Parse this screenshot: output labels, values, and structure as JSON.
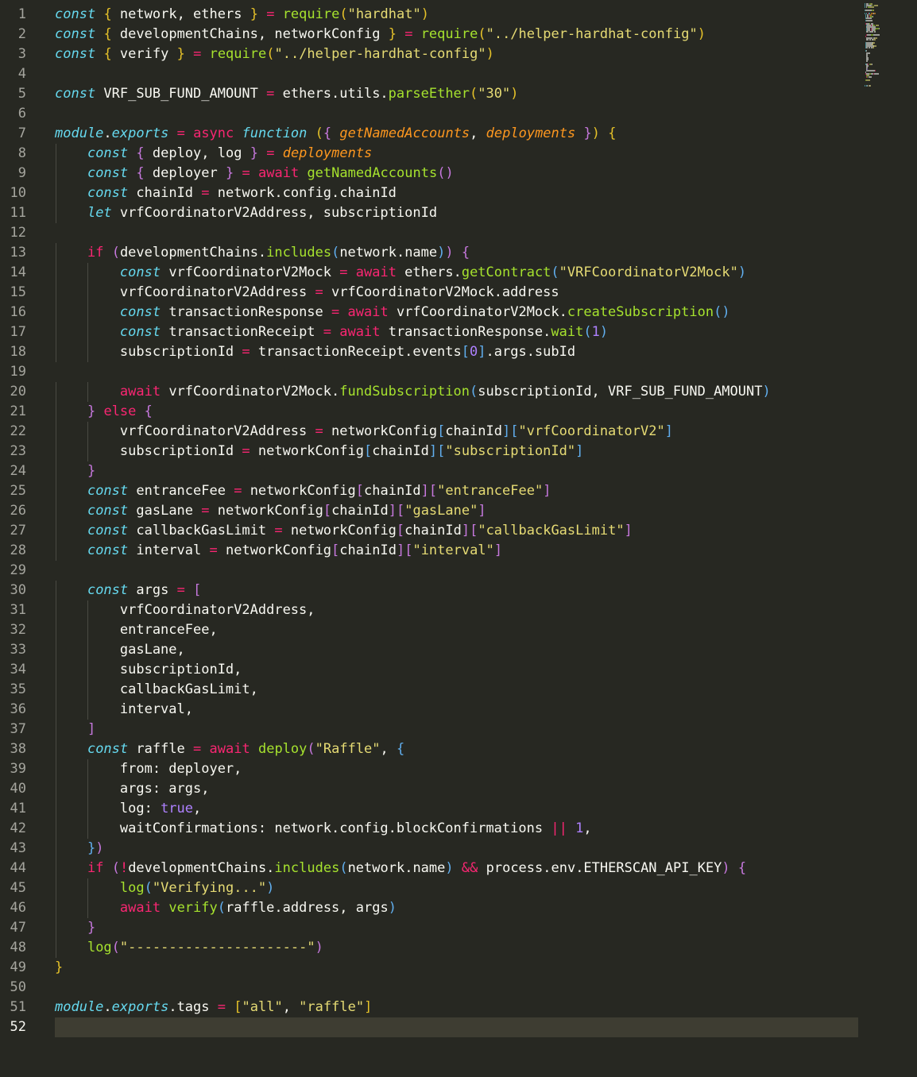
{
  "editor": {
    "language": "javascript",
    "current_line": 52,
    "lines": [
      [
        [
          "kwi",
          "const"
        ],
        [
          "p",
          " "
        ],
        [
          "br",
          "{"
        ],
        [
          "p",
          " network, ethers "
        ],
        [
          "br",
          "}"
        ],
        [
          "p",
          " "
        ],
        [
          "op",
          "="
        ],
        [
          "p",
          " "
        ],
        [
          "fn",
          "require"
        ],
        [
          "br",
          "("
        ],
        [
          "str",
          "\"hardhat\""
        ],
        [
          "br",
          ")"
        ]
      ],
      [
        [
          "kwi",
          "const"
        ],
        [
          "p",
          " "
        ],
        [
          "br",
          "{"
        ],
        [
          "p",
          " developmentChains, networkConfig "
        ],
        [
          "br",
          "}"
        ],
        [
          "p",
          " "
        ],
        [
          "op",
          "="
        ],
        [
          "p",
          " "
        ],
        [
          "fn",
          "require"
        ],
        [
          "br",
          "("
        ],
        [
          "str",
          "\"../helper-hardhat-config\""
        ],
        [
          "br",
          ")"
        ]
      ],
      [
        [
          "kwi",
          "const"
        ],
        [
          "p",
          " "
        ],
        [
          "br",
          "{"
        ],
        [
          "p",
          " verify "
        ],
        [
          "br",
          "}"
        ],
        [
          "p",
          " "
        ],
        [
          "op",
          "="
        ],
        [
          "p",
          " "
        ],
        [
          "fn",
          "require"
        ],
        [
          "br",
          "("
        ],
        [
          "str",
          "\"../helper-hardhat-config\""
        ],
        [
          "br",
          ")"
        ]
      ],
      [],
      [
        [
          "kwi",
          "const"
        ],
        [
          "p",
          " VRF_SUB_FUND_AMOUNT "
        ],
        [
          "op",
          "="
        ],
        [
          "p",
          " ethers.utils."
        ],
        [
          "fn",
          "parseEther"
        ],
        [
          "br",
          "("
        ],
        [
          "str",
          "\"30\""
        ],
        [
          "br",
          ")"
        ]
      ],
      [],
      [
        [
          "kwi",
          "module"
        ],
        [
          "p",
          "."
        ],
        [
          "kwi",
          "exports"
        ],
        [
          "p",
          " "
        ],
        [
          "op",
          "="
        ],
        [
          "p",
          " "
        ],
        [
          "kw",
          "async"
        ],
        [
          "p",
          " "
        ],
        [
          "kwi",
          "function"
        ],
        [
          "p",
          " "
        ],
        [
          "br",
          "("
        ],
        [
          "br",
          "{"
        ],
        [
          "p",
          " "
        ],
        [
          "prm",
          "getNamedAccounts"
        ],
        [
          "p",
          ", "
        ],
        [
          "prm",
          "deployments"
        ],
        [
          "p",
          " "
        ],
        [
          "br",
          "}"
        ],
        [
          "br",
          ")"
        ],
        [
          "p",
          " "
        ],
        [
          "br",
          "{"
        ]
      ],
      [
        [
          "p",
          "    "
        ],
        [
          "kwi",
          "const"
        ],
        [
          "p",
          " "
        ],
        [
          "br",
          "{"
        ],
        [
          "p",
          " deploy, log "
        ],
        [
          "br",
          "}"
        ],
        [
          "p",
          " "
        ],
        [
          "op",
          "="
        ],
        [
          "p",
          " "
        ],
        [
          "prm",
          "deployments"
        ]
      ],
      [
        [
          "p",
          "    "
        ],
        [
          "kwi",
          "const"
        ],
        [
          "p",
          " "
        ],
        [
          "br",
          "{"
        ],
        [
          "p",
          " deployer "
        ],
        [
          "br",
          "}"
        ],
        [
          "p",
          " "
        ],
        [
          "op",
          "="
        ],
        [
          "p",
          " "
        ],
        [
          "kw",
          "await"
        ],
        [
          "p",
          " "
        ],
        [
          "fn",
          "getNamedAccounts"
        ],
        [
          "br",
          "()"
        ]
      ],
      [
        [
          "p",
          "    "
        ],
        [
          "kwi",
          "const"
        ],
        [
          "p",
          " chainId "
        ],
        [
          "op",
          "="
        ],
        [
          "p",
          " network.config.chainId"
        ]
      ],
      [
        [
          "p",
          "    "
        ],
        [
          "kwi",
          "let"
        ],
        [
          "p",
          " vrfCoordinatorV2Address, subscriptionId"
        ]
      ],
      [],
      [
        [
          "p",
          "    "
        ],
        [
          "kw",
          "if"
        ],
        [
          "p",
          " "
        ],
        [
          "br",
          "("
        ],
        [
          "p",
          "developmentChains."
        ],
        [
          "fn",
          "includes"
        ],
        [
          "br",
          "("
        ],
        [
          "p",
          "network.name"
        ],
        [
          "br",
          "))"
        ],
        [
          "p",
          " "
        ],
        [
          "br",
          "{"
        ]
      ],
      [
        [
          "p",
          "        "
        ],
        [
          "kwi",
          "const"
        ],
        [
          "p",
          " vrfCoordinatorV2Mock "
        ],
        [
          "op",
          "="
        ],
        [
          "p",
          " "
        ],
        [
          "kw",
          "await"
        ],
        [
          "p",
          " ethers."
        ],
        [
          "fn",
          "getContract"
        ],
        [
          "br",
          "("
        ],
        [
          "str",
          "\"VRFCoordinatorV2Mock\""
        ],
        [
          "br",
          ")"
        ]
      ],
      [
        [
          "p",
          "        vrfCoordinatorV2Address "
        ],
        [
          "op",
          "="
        ],
        [
          "p",
          " vrfCoordinatorV2Mock.address"
        ]
      ],
      [
        [
          "p",
          "        "
        ],
        [
          "kwi",
          "const"
        ],
        [
          "p",
          " transactionResponse "
        ],
        [
          "op",
          "="
        ],
        [
          "p",
          " "
        ],
        [
          "kw",
          "await"
        ],
        [
          "p",
          " vrfCoordinatorV2Mock."
        ],
        [
          "fn",
          "createSubscription"
        ],
        [
          "br",
          "()"
        ]
      ],
      [
        [
          "p",
          "        "
        ],
        [
          "kwi",
          "const"
        ],
        [
          "p",
          " transactionReceipt "
        ],
        [
          "op",
          "="
        ],
        [
          "p",
          " "
        ],
        [
          "kw",
          "await"
        ],
        [
          "p",
          " transactionResponse."
        ],
        [
          "fn",
          "wait"
        ],
        [
          "br",
          "("
        ],
        [
          "num",
          "1"
        ],
        [
          "br",
          ")"
        ]
      ],
      [
        [
          "p",
          "        subscriptionId "
        ],
        [
          "op",
          "="
        ],
        [
          "p",
          " transactionReceipt.events"
        ],
        [
          "br",
          "["
        ],
        [
          "num",
          "0"
        ],
        [
          "br",
          "]"
        ],
        [
          "p",
          ".args.subId"
        ]
      ],
      [],
      [
        [
          "p",
          "        "
        ],
        [
          "kw",
          "await"
        ],
        [
          "p",
          " vrfCoordinatorV2Mock."
        ],
        [
          "fn",
          "fundSubscription"
        ],
        [
          "br",
          "("
        ],
        [
          "p",
          "subscriptionId, VRF_SUB_FUND_AMOUNT"
        ],
        [
          "br",
          ")"
        ]
      ],
      [
        [
          "p",
          "    "
        ],
        [
          "br",
          "}"
        ],
        [
          "p",
          " "
        ],
        [
          "kw",
          "else"
        ],
        [
          "p",
          " "
        ],
        [
          "br",
          "{"
        ]
      ],
      [
        [
          "p",
          "        vrfCoordinatorV2Address "
        ],
        [
          "op",
          "="
        ],
        [
          "p",
          " networkConfig"
        ],
        [
          "br",
          "["
        ],
        [
          "p",
          "chainId"
        ],
        [
          "br",
          "]["
        ],
        [
          "str",
          "\"vrfCoordinatorV2\""
        ],
        [
          "br",
          "]"
        ]
      ],
      [
        [
          "p",
          "        subscriptionId "
        ],
        [
          "op",
          "="
        ],
        [
          "p",
          " networkConfig"
        ],
        [
          "br",
          "["
        ],
        [
          "p",
          "chainId"
        ],
        [
          "br",
          "]["
        ],
        [
          "str",
          "\"subscriptionId\""
        ],
        [
          "br",
          "]"
        ]
      ],
      [
        [
          "p",
          "    "
        ],
        [
          "br",
          "}"
        ]
      ],
      [
        [
          "p",
          "    "
        ],
        [
          "kwi",
          "const"
        ],
        [
          "p",
          " entranceFee "
        ],
        [
          "op",
          "="
        ],
        [
          "p",
          " networkConfig"
        ],
        [
          "br",
          "["
        ],
        [
          "p",
          "chainId"
        ],
        [
          "br",
          "]["
        ],
        [
          "str",
          "\"entranceFee\""
        ],
        [
          "br",
          "]"
        ]
      ],
      [
        [
          "p",
          "    "
        ],
        [
          "kwi",
          "const"
        ],
        [
          "p",
          " gasLane "
        ],
        [
          "op",
          "="
        ],
        [
          "p",
          " networkConfig"
        ],
        [
          "br",
          "["
        ],
        [
          "p",
          "chainId"
        ],
        [
          "br",
          "]["
        ],
        [
          "str",
          "\"gasLane\""
        ],
        [
          "br",
          "]"
        ]
      ],
      [
        [
          "p",
          "    "
        ],
        [
          "kwi",
          "const"
        ],
        [
          "p",
          " callbackGasLimit "
        ],
        [
          "op",
          "="
        ],
        [
          "p",
          " networkConfig"
        ],
        [
          "br",
          "["
        ],
        [
          "p",
          "chainId"
        ],
        [
          "br",
          "]["
        ],
        [
          "str",
          "\"callbackGasLimit\""
        ],
        [
          "br",
          "]"
        ]
      ],
      [
        [
          "p",
          "    "
        ],
        [
          "kwi",
          "const"
        ],
        [
          "p",
          " interval "
        ],
        [
          "op",
          "="
        ],
        [
          "p",
          " networkConfig"
        ],
        [
          "br",
          "["
        ],
        [
          "p",
          "chainId"
        ],
        [
          "br",
          "]["
        ],
        [
          "str",
          "\"interval\""
        ],
        [
          "br",
          "]"
        ]
      ],
      [],
      [
        [
          "p",
          "    "
        ],
        [
          "kwi",
          "const"
        ],
        [
          "p",
          " args "
        ],
        [
          "op",
          "="
        ],
        [
          "p",
          " "
        ],
        [
          "br",
          "["
        ]
      ],
      [
        [
          "p",
          "        vrfCoordinatorV2Address,"
        ]
      ],
      [
        [
          "p",
          "        entranceFee,"
        ]
      ],
      [
        [
          "p",
          "        gasLane,"
        ]
      ],
      [
        [
          "p",
          "        subscriptionId,"
        ]
      ],
      [
        [
          "p",
          "        callbackGasLimit,"
        ]
      ],
      [
        [
          "p",
          "        interval,"
        ]
      ],
      [
        [
          "p",
          "    "
        ],
        [
          "br",
          "]"
        ]
      ],
      [
        [
          "p",
          "    "
        ],
        [
          "kwi",
          "const"
        ],
        [
          "p",
          " raffle "
        ],
        [
          "op",
          "="
        ],
        [
          "p",
          " "
        ],
        [
          "kw",
          "await"
        ],
        [
          "p",
          " "
        ],
        [
          "fn",
          "deploy"
        ],
        [
          "br",
          "("
        ],
        [
          "str",
          "\"Raffle\""
        ],
        [
          "p",
          ", "
        ],
        [
          "br",
          "{"
        ]
      ],
      [
        [
          "p",
          "        from: deployer,"
        ]
      ],
      [
        [
          "p",
          "        args: args,"
        ]
      ],
      [
        [
          "p",
          "        log: "
        ],
        [
          "num",
          "true"
        ],
        [
          "p",
          ","
        ]
      ],
      [
        [
          "p",
          "        waitConfirmations: network.config.blockConfirmations "
        ],
        [
          "op",
          "||"
        ],
        [
          "p",
          " "
        ],
        [
          "num",
          "1"
        ],
        [
          "p",
          ","
        ]
      ],
      [
        [
          "p",
          "    "
        ],
        [
          "br",
          "})"
        ]
      ],
      [
        [
          "p",
          "    "
        ],
        [
          "kw",
          "if"
        ],
        [
          "p",
          " "
        ],
        [
          "br",
          "("
        ],
        [
          "op",
          "!"
        ],
        [
          "p",
          "developmentChains."
        ],
        [
          "fn",
          "includes"
        ],
        [
          "br",
          "("
        ],
        [
          "p",
          "network.name"
        ],
        [
          "br",
          ")"
        ],
        [
          "p",
          " "
        ],
        [
          "op",
          "&&"
        ],
        [
          "p",
          " process.env.ETHERSCAN_API_KEY"
        ],
        [
          "br",
          ")"
        ],
        [
          "p",
          " "
        ],
        [
          "br",
          "{"
        ]
      ],
      [
        [
          "p",
          "        "
        ],
        [
          "fn",
          "log"
        ],
        [
          "br",
          "("
        ],
        [
          "str",
          "\"Verifying...\""
        ],
        [
          "br",
          ")"
        ]
      ],
      [
        [
          "p",
          "        "
        ],
        [
          "kw",
          "await"
        ],
        [
          "p",
          " "
        ],
        [
          "fn",
          "verify"
        ],
        [
          "br",
          "("
        ],
        [
          "p",
          "raffle.address, args"
        ],
        [
          "br",
          ")"
        ]
      ],
      [
        [
          "p",
          "    "
        ],
        [
          "br",
          "}"
        ]
      ],
      [
        [
          "p",
          "    "
        ],
        [
          "fn",
          "log"
        ],
        [
          "br",
          "("
        ],
        [
          "str",
          "\"----------------------\""
        ],
        [
          "br",
          ")"
        ]
      ],
      [
        [
          "br",
          "}"
        ]
      ],
      [],
      [
        [
          "kwi",
          "module"
        ],
        [
          "p",
          "."
        ],
        [
          "kwi",
          "exports"
        ],
        [
          "p",
          ".tags "
        ],
        [
          "op",
          "="
        ],
        [
          "p",
          " "
        ],
        [
          "br",
          "["
        ],
        [
          "str",
          "\"all\""
        ],
        [
          "p",
          ", "
        ],
        [
          "str",
          "\"raffle\""
        ],
        [
          "br",
          "]"
        ]
      ],
      []
    ]
  },
  "theme": {
    "background": "#272822",
    "current_line_bg": "#3e3d32",
    "colors": {
      "p": "#f8f8f2",
      "kwi": "#66d9ef",
      "kw": "#f92672",
      "op": "#f92672",
      "fn": "#a6e22e",
      "str": "#e6db74",
      "num": "#ae81ff",
      "prm": "#fd971f",
      "br": "#f8f8f2"
    },
    "bracket_colors": [
      "#e6c229",
      "#c678dd",
      "#61afef"
    ]
  }
}
